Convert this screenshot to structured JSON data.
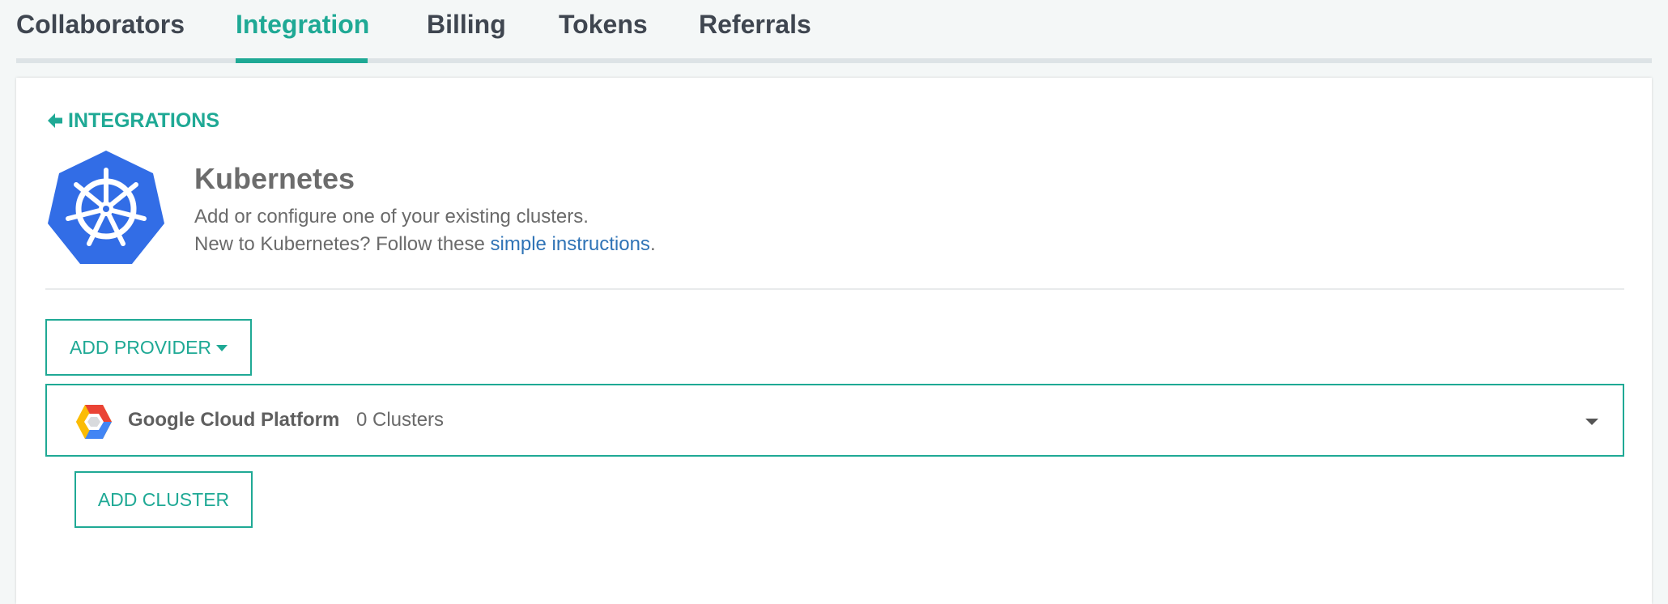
{
  "tabs": [
    {
      "label": "Collaborators"
    },
    {
      "label": "Integration"
    },
    {
      "label": "Billing"
    },
    {
      "label": "Tokens"
    },
    {
      "label": "Referrals"
    }
  ],
  "active_tab": "Integration",
  "back_link": {
    "label": "INTEGRATIONS",
    "icon": "arrow-left-icon"
  },
  "integration": {
    "title": "Kubernetes",
    "description_line1": "Add or configure one of your existing clusters.",
    "description_line2_prefix": "New to Kubernetes? Follow these ",
    "description_line2_link": "simple instructions",
    "description_line2_suffix": ".",
    "logo": "kubernetes-logo"
  },
  "add_provider_button": {
    "label": "ADD PROVIDER",
    "icon": "caret-down-icon"
  },
  "providers": [
    {
      "name": "Google Cloud Platform",
      "clusters": "0 Clusters",
      "logo": "google-cloud-logo",
      "expand_icon": "caret-down-icon"
    }
  ],
  "add_cluster_button": {
    "label": "ADD CLUSTER"
  },
  "colors": {
    "accent": "#1fa995",
    "link": "#2f73b6",
    "kubernetes_blue": "#326de6",
    "tab_text": "#3f4650"
  }
}
